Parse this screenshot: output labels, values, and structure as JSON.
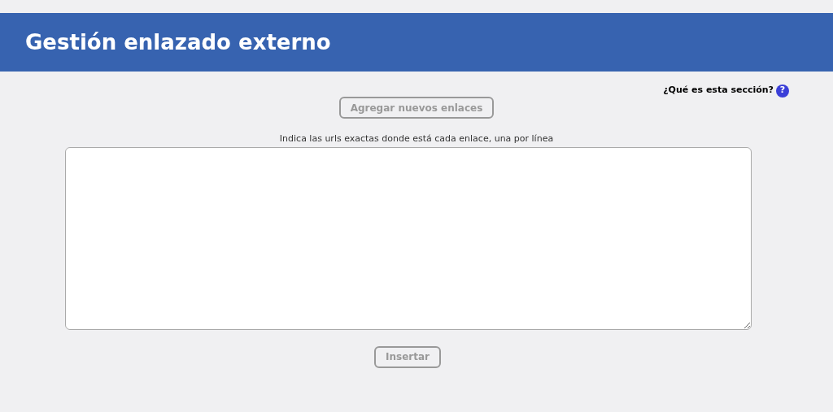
{
  "header": {
    "title": "Gestión enlazado externo"
  },
  "help_link": {
    "label": "¿Qué es esta sección?",
    "icon": "?"
  },
  "add_button": {
    "label": "Agregar nuevos enlaces",
    "disabled": true
  },
  "urls_field": {
    "label": "Indica las urls exactas donde está cada enlace, una por línea"
  },
  "insert_button": {
    "label": "Insertar",
    "disabled": true
  }
}
